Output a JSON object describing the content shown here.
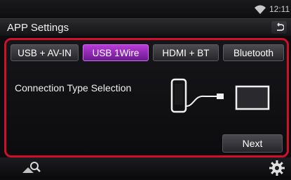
{
  "status": {
    "time": "12:11"
  },
  "header": {
    "title": "APP Settings"
  },
  "tabs": [
    {
      "label": "USB + AV-IN",
      "active": false
    },
    {
      "label": "USB 1Wire",
      "active": true
    },
    {
      "label": "HDMI + BT",
      "active": false
    },
    {
      "label": "Bluetooth",
      "active": false
    }
  ],
  "main": {
    "connection_label": "Connection Type Selection",
    "next_label": "Next"
  },
  "colors": {
    "highlight_border": "#d0102a",
    "active_tab": "#9a2ec0"
  },
  "icons": {
    "status": "wifi-icon",
    "back": "back-arrow-icon",
    "phone": "smartphone-icon",
    "cable": "usb-cable-icon",
    "display": "display-icon",
    "nav": "search-map-icon",
    "settings": "gear-icon"
  }
}
